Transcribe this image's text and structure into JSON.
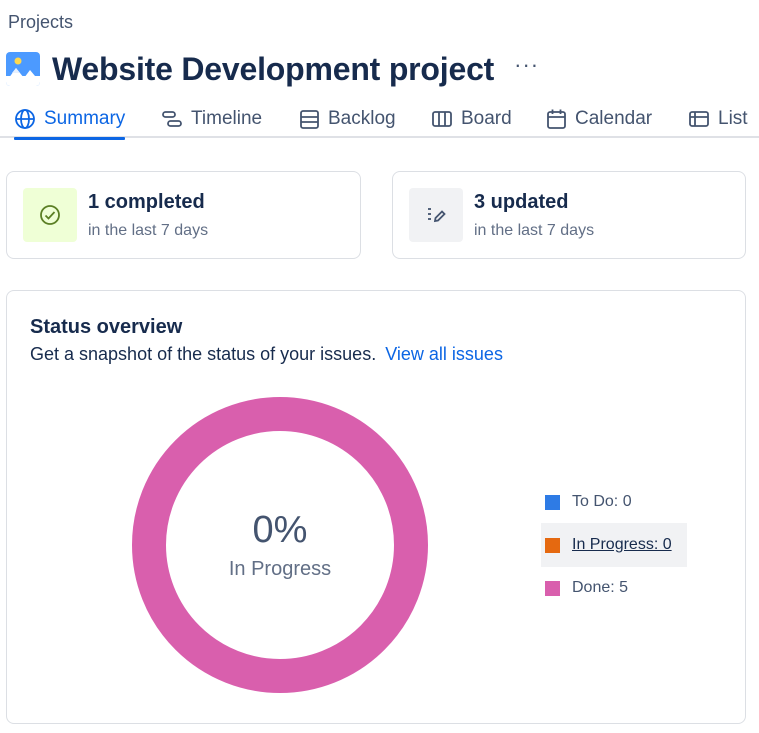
{
  "breadcrumb": "Projects",
  "project": {
    "title": "Website Development project",
    "more_label": "···"
  },
  "tabs": [
    {
      "label": "Summary",
      "icon": "globe-icon",
      "active": true
    },
    {
      "label": "Timeline",
      "icon": "timeline-icon"
    },
    {
      "label": "Backlog",
      "icon": "backlog-icon"
    },
    {
      "label": "Board",
      "icon": "board-icon"
    },
    {
      "label": "Calendar",
      "icon": "calendar-icon"
    },
    {
      "label": "List",
      "icon": "list-icon"
    }
  ],
  "stats": [
    {
      "title": "1 completed",
      "subtitle": "in the last 7 days",
      "icon": "check-circle-icon"
    },
    {
      "title": "3 updated",
      "subtitle": "in the last 7 days",
      "icon": "edit-list-icon"
    }
  ],
  "status_overview": {
    "title": "Status overview",
    "description": "Get a snapshot of the status of your issues.",
    "link": "View all issues",
    "center_percent": "0%",
    "center_label": "In Progress",
    "legend": [
      {
        "label": "To Do: 0",
        "color": "#2e7be5",
        "count": 0
      },
      {
        "label": "In Progress: 0",
        "color": "#e56910",
        "count": 0
      },
      {
        "label": "Done: 5",
        "color": "#d95fad",
        "count": 5
      }
    ]
  },
  "colors": {
    "accent": "#0c66e4",
    "done": "#d95fad",
    "todo": "#2e7be5",
    "in_progress": "#e56910",
    "completed_icon_bg": "#efffd6",
    "updated_icon_bg": "#f1f2f4"
  }
}
